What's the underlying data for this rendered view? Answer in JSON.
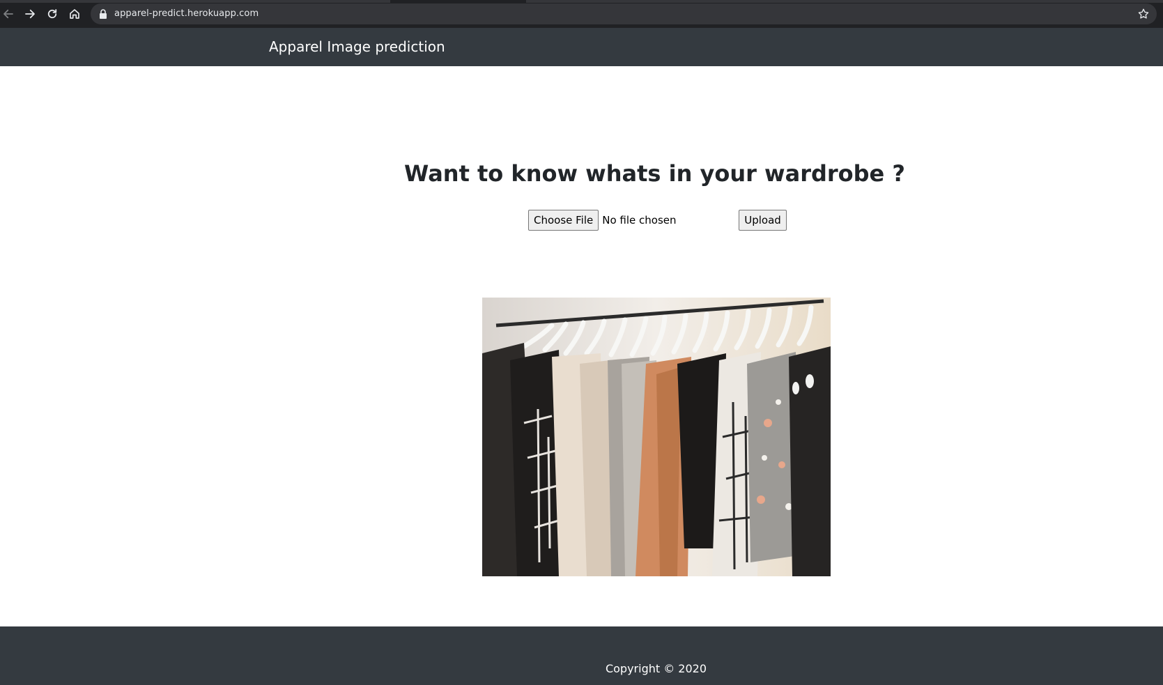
{
  "browser": {
    "url": "apparel-predict.herokuapp.com",
    "icons": [
      "back-arrow-icon",
      "forward-arrow-icon",
      "reload-icon",
      "home-icon",
      "lock-icon",
      "star-icon"
    ]
  },
  "navbar": {
    "brand": "Apparel Image prediction",
    "background": "#343a40"
  },
  "main": {
    "heading": "Want to know whats in your wardrobe ?",
    "file_input": {
      "button_label": "Choose File",
      "status": "No file chosen"
    },
    "upload_label": "Upload",
    "image_subject": "clothes on hangers"
  },
  "footer": {
    "copyright": "Copyright © 2020",
    "background": "#343a40"
  }
}
